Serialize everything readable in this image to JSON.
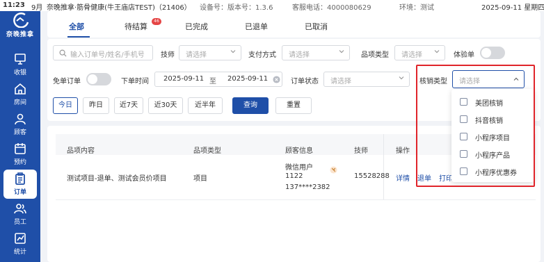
{
  "status_bar": {
    "time": "11:23",
    "date_short": "9月",
    "title": "奈晚推拿·筋骨健康(牛王庙店TEST)（21406）",
    "device": "设备号：版本号：1.3.6",
    "service_phone": "客服电话：4000080629",
    "env": "环境：测试",
    "datetime": "2025-09-11 星期四"
  },
  "sidebar": {
    "logo_text": "奈晚推拿",
    "items": [
      {
        "label": "收银",
        "icon": "monitor-icon"
      },
      {
        "label": "房间",
        "icon": "home-icon"
      },
      {
        "label": "顾客",
        "icon": "user-icon"
      },
      {
        "label": "预约",
        "icon": "calendar-icon"
      },
      {
        "label": "订单",
        "icon": "clipboard-icon",
        "active": true
      },
      {
        "label": "员工",
        "icon": "users-icon"
      },
      {
        "label": "统计",
        "icon": "chart-icon"
      }
    ]
  },
  "tabs": [
    {
      "label": "全部",
      "active": true
    },
    {
      "label": "待结算",
      "badge": "46"
    },
    {
      "label": "已完成"
    },
    {
      "label": "已退单"
    },
    {
      "label": "已取消"
    }
  ],
  "filters": {
    "search_placeholder": "输入订单号/姓名/手机号",
    "technician_label": "技师",
    "technician_placeholder": "请选择",
    "payment_label": "支付方式",
    "payment_placeholder": "请选择",
    "category_label": "品项类型",
    "category_placeholder": "请选择",
    "trial_label": "体验单",
    "free_label": "免单订单",
    "time_label": "下单时间",
    "date_from": "2025-09-11",
    "date_sep": "至",
    "date_to": "2025-09-11",
    "status_label": "订单状态",
    "status_placeholder": "请选择",
    "verify_label": "核销类型",
    "verify_placeholder": "请选择"
  },
  "quick_ranges": [
    "今日",
    "昨日",
    "近7天",
    "近30天",
    "近半年"
  ],
  "query_button": "查询",
  "reset_button": "重置",
  "table": {
    "headers": [
      "品项内容",
      "品项类型",
      "顾客信息",
      "技师",
      "操作"
    ],
    "row": {
      "item": "测试项目-退单、测试会员价项目",
      "type": "项目",
      "customer_line1": "微信用户",
      "customer_line2": "1122",
      "customer_line3": "137****2382",
      "technician": "15528288",
      "actions": [
        "详情",
        "退单",
        "打印"
      ]
    }
  },
  "verify_options": [
    "美团核销",
    "抖音核销",
    "小程序项目",
    "小程序产品",
    "小程序优惠券"
  ],
  "colors": {
    "primary": "#1f4fa8",
    "highlight": "#e0242a",
    "badge": "#e54545"
  }
}
